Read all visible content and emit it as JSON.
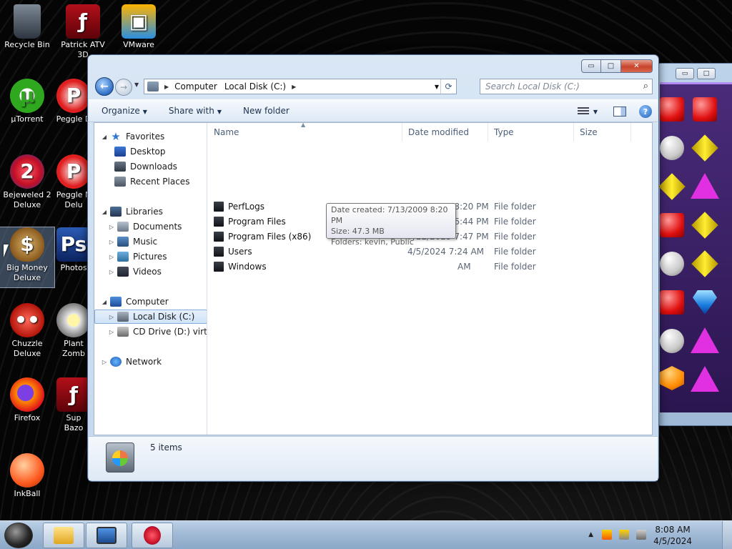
{
  "desktop": {
    "icons": [
      {
        "label": "Recycle Bin",
        "icon": "recycle-bin-icon"
      },
      {
        "label": "Patrick ATV 3D",
        "icon": "flash-icon"
      },
      {
        "label": "VMware",
        "icon": "vmware-icon"
      },
      {
        "label": "µTorrent",
        "icon": "utorrent-icon"
      },
      {
        "label": "Peggle D",
        "icon": "peggle-icon"
      },
      {
        "label": "Bejeweled 2 Deluxe",
        "icon": "bejeweled-icon"
      },
      {
        "label": "Peggle N Delu",
        "icon": "peggle-nights-icon"
      },
      {
        "label": "Big Money Deluxe",
        "icon": "money-bag-icon"
      },
      {
        "label": "Photos",
        "icon": "photoshop-icon"
      },
      {
        "label": "Chuzzle Deluxe",
        "icon": "chuzzle-icon"
      },
      {
        "label": "Plant Zomb",
        "icon": "plants-zombies-icon"
      },
      {
        "label": "Firefox",
        "icon": "firefox-icon"
      },
      {
        "label": "Sup Bazo",
        "icon": "flash-icon"
      },
      {
        "label": "InkBall",
        "icon": "inkball-icon"
      }
    ]
  },
  "explorer": {
    "caption": {
      "minimize": "▭",
      "maximize": "□",
      "close": "✕"
    },
    "address": {
      "crumbs": [
        "Computer",
        "Local Disk (C:)"
      ]
    },
    "search": {
      "placeholder": "Search Local Disk (C:)"
    },
    "toolbar": {
      "organize": "Organize",
      "share_with": "Share with",
      "new_folder": "New folder"
    },
    "nav": {
      "favorites": "Favorites",
      "desktop": "Desktop",
      "downloads": "Downloads",
      "recent_places": "Recent Places",
      "libraries": "Libraries",
      "documents": "Documents",
      "music": "Music",
      "pictures": "Pictures",
      "videos": "Videos",
      "computer": "Computer",
      "local_disk": "Local Disk (C:)",
      "cd_drive": "CD Drive (D:) virtio-w",
      "network": "Network"
    },
    "columns": {
      "name": "Name",
      "date_modified": "Date modified",
      "type": "Type",
      "size": "Size"
    },
    "files": [
      {
        "name": "PerfLogs",
        "date": "7/13/2009 8:20 PM",
        "type": "File folder"
      },
      {
        "name": "Program Files",
        "date": "7/13/2023 6:44 PM",
        "type": "File folder"
      },
      {
        "name": "Program Files (x86)",
        "date": "7/12/2023 7:47 PM",
        "type": "File folder"
      },
      {
        "name": "Users",
        "date": "4/5/2024 7:24 AM",
        "type": "File folder"
      },
      {
        "name": "Windows",
        "date": "AM",
        "type": "File folder"
      }
    ],
    "tooltip": {
      "created": "Date created: 7/13/2009 8:20 PM",
      "size": "Size: 47.3 MB",
      "folders": "Folders: kevin, Public"
    },
    "details": {
      "count": "5 items"
    }
  },
  "taskbar": {
    "clock_time": "8:08 AM",
    "clock_date": "4/5/2024"
  },
  "colors": {
    "accent": "#2f6fc4",
    "close": "#c7432b"
  }
}
